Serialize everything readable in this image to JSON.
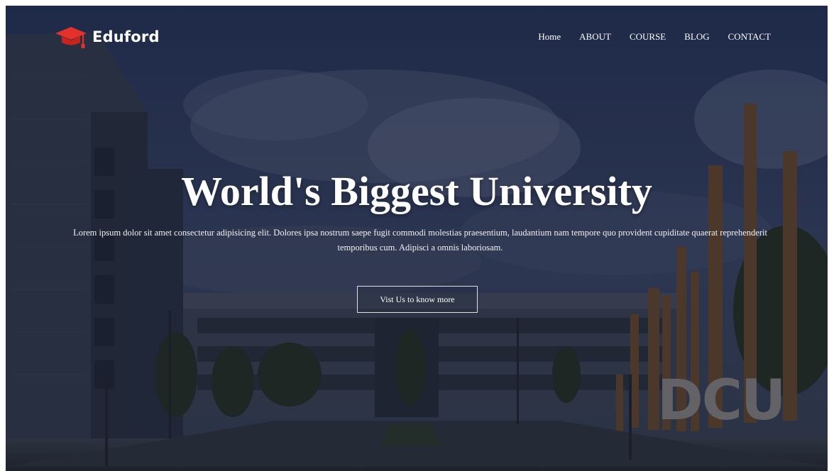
{
  "brand": {
    "name": "Eduford",
    "icon": "graduation-cap-icon",
    "accent": "#e4322b"
  },
  "nav": {
    "items": [
      {
        "label": "Home"
      },
      {
        "label": "ABOUT"
      },
      {
        "label": "COURSE"
      },
      {
        "label": "BLOG"
      },
      {
        "label": "CONTACT"
      }
    ]
  },
  "hero": {
    "title": "World's Biggest University",
    "text": "Lorem ipsum dolor sit amet consectetur adipisicing elit. Dolores ipsa nostrum saepe fugit commodi molestias praesentium, laudantium nam tempore quo provident cupiditate quaerat reprehenderit temporibus cum. Adipisci a omnis laboriosam.",
    "cta_label": "Vist Us to know more"
  },
  "background": {
    "sign_text": "DCU"
  }
}
